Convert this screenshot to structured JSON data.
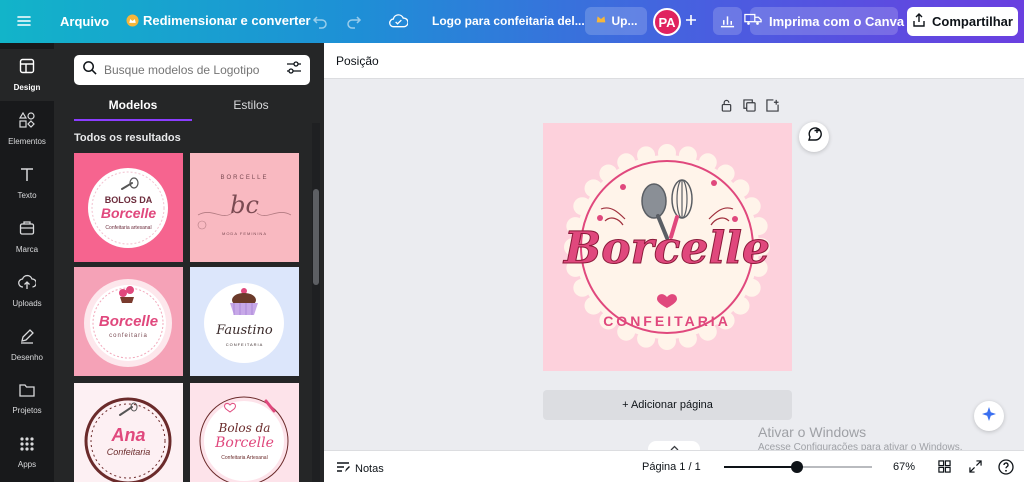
{
  "topbar": {
    "menu_label": "Arquivo",
    "resize_label": "Redimensionar e converter",
    "doc_title": "Logo para confeitaria del...",
    "upgrade_label": "Up...",
    "avatar_initials": "PA",
    "print_label": "Imprima com o Canva",
    "share_label": "Compartilhar"
  },
  "rail": {
    "items": [
      {
        "label": "Design",
        "icon": "design-icon"
      },
      {
        "label": "Elementos",
        "icon": "elements-icon"
      },
      {
        "label": "Texto",
        "icon": "text-icon"
      },
      {
        "label": "Marca",
        "icon": "brand-icon"
      },
      {
        "label": "Uploads",
        "icon": "upload-icon"
      },
      {
        "label": "Desenho",
        "icon": "draw-icon"
      },
      {
        "label": "Projetos",
        "icon": "folder-icon"
      },
      {
        "label": "Apps",
        "icon": "apps-icon"
      }
    ]
  },
  "panel": {
    "search_placeholder": "Busque modelos de Logotipo",
    "tabs": [
      "Modelos",
      "Estilos"
    ],
    "section_title": "Todos os resultados",
    "templates": [
      {
        "line1": "BOLOS DA",
        "line2": "Borcelle",
        "line3": "Confeitaria artesanal"
      },
      {
        "line1": "BORCELLE",
        "line2": "bc",
        "line3": "MODA FEMININA"
      },
      {
        "line1": "Borcelle",
        "line2": "confeitaria"
      },
      {
        "line1": "Faustino",
        "line2": "CONFEITARIA"
      },
      {
        "line1": "Ana",
        "line2": "Confeitaria"
      },
      {
        "line1": "Bolos da",
        "line2": "Borcelle",
        "line3": "Confeitaria Artesanal"
      }
    ]
  },
  "main": {
    "position_label": "Posição",
    "logo_brand": "Borcelle",
    "logo_tagline": "CONFEITARIA",
    "add_page_label": "+ Adicionar página",
    "watermark_title": "Ativar o Windows",
    "watermark_sub": "Acesse Configurações para ativar o Windows."
  },
  "bottombar": {
    "notes_label": "Notas",
    "page_indicator": "Página 1 / 1",
    "zoom_label": "67%",
    "zoom_fraction": 0.49
  },
  "colors": {
    "accent": "#8b3dff",
    "logo_pink": "#e0487d",
    "page_bg": "#fdd1dc"
  }
}
